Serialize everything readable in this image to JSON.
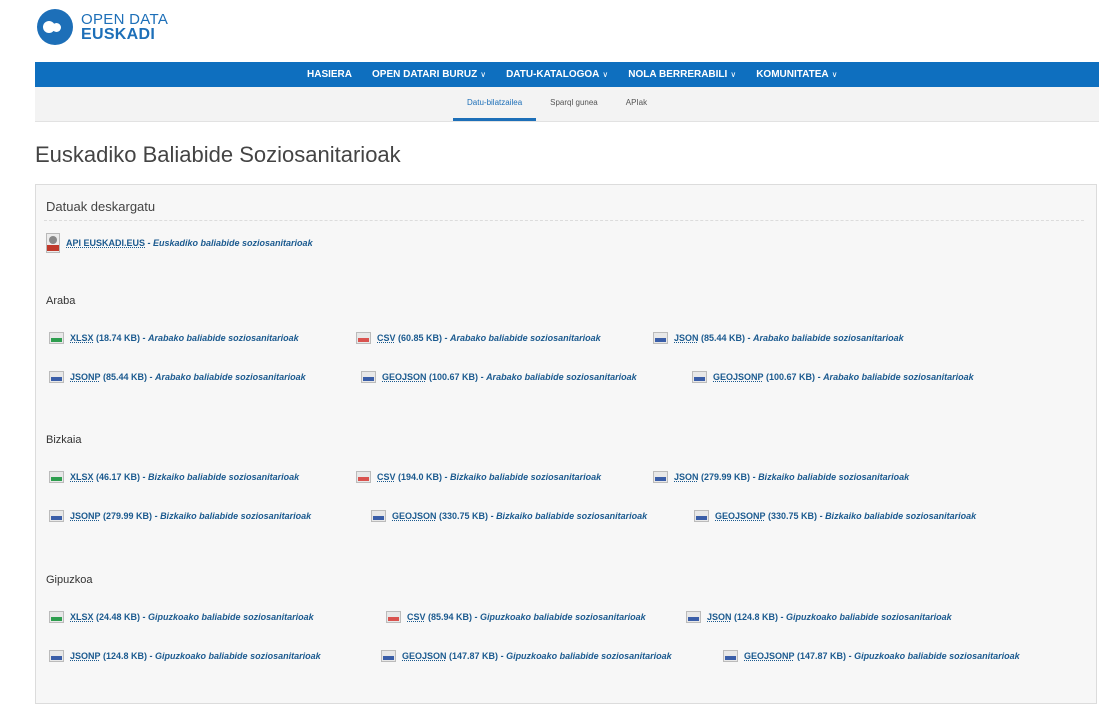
{
  "logo": {
    "line1": "OPEN DATA",
    "line2": "EUSKADI"
  },
  "mainnav": [
    {
      "label": "HASIERA",
      "dropdown": false
    },
    {
      "label": "OPEN DATARI BURUZ",
      "dropdown": true
    },
    {
      "label": "DATU-KATALOGOA",
      "dropdown": true
    },
    {
      "label": "NOLA BERRERABILI",
      "dropdown": true
    },
    {
      "label": "KOMUNITATEA",
      "dropdown": true
    }
  ],
  "subnav": [
    {
      "label": "Datu-bilatzailea",
      "active": true
    },
    {
      "label": "Sparql gunea",
      "active": false
    },
    {
      "label": "APIak",
      "active": false
    }
  ],
  "page_title": "Euskadiko Baliabide Soziosanitarioak",
  "panel": {
    "title": "Datuak deskargatu",
    "api": {
      "label": "API EUSKADI.EUS",
      "desc": "Euskadiko baliabide soziosanitarioak"
    }
  },
  "icon_colors": {
    "XLSX": "#2e9e4f",
    "CSV": "#d9534f",
    "JSON": "#3a5ea8",
    "JSONP": "#3a5ea8",
    "GEOJSON": "#3a5ea8",
    "GEOJSONP": "#3a5ea8"
  },
  "sections": [
    {
      "name": "Araba",
      "rows": [
        [
          {
            "fmt": "XLSX",
            "size": "(18.74 KB)",
            "desc": "Arabako baliabide soziosanitarioak"
          },
          {
            "fmt": "CSV",
            "size": "(60.85 KB)",
            "desc": "Arabako baliabide soziosanitarioak"
          },
          {
            "fmt": "JSON",
            "size": "(85.44 KB)",
            "desc": "Arabako baliabide soziosanitarioak"
          }
        ],
        [
          {
            "fmt": "JSONP",
            "size": "(85.44 KB)",
            "desc": "Arabako baliabide soziosanitarioak"
          },
          {
            "fmt": "GEOJSON",
            "size": "(100.67 KB)",
            "desc": "Arabako baliabide soziosanitarioak"
          },
          {
            "fmt": "GEOJSONP",
            "size": "(100.67 KB)",
            "desc": "Arabako baliabide soziosanitarioak"
          }
        ]
      ]
    },
    {
      "name": "Bizkaia",
      "rows": [
        [
          {
            "fmt": "XLSX",
            "size": "(46.17 KB)",
            "desc": "Bizkaiko baliabide soziosanitarioak"
          },
          {
            "fmt": "CSV",
            "size": "(194.0 KB)",
            "desc": "Bizkaiko baliabide soziosanitarioak"
          },
          {
            "fmt": "JSON",
            "size": "(279.99 KB)",
            "desc": "Bizkaiko baliabide soziosanitarioak"
          }
        ],
        [
          {
            "fmt": "JSONP",
            "size": "(279.99 KB)",
            "desc": "Bizkaiko baliabide soziosanitarioak"
          },
          {
            "fmt": "GEOJSON",
            "size": "(330.75 KB)",
            "desc": "Bizkaiko baliabide soziosanitarioak"
          },
          {
            "fmt": "GEOJSONP",
            "size": "(330.75 KB)",
            "desc": "Bizkaiko baliabide soziosanitarioak"
          }
        ]
      ]
    },
    {
      "name": "Gipuzkoa",
      "rows": [
        [
          {
            "fmt": "XLSX",
            "size": "(24.48 KB)",
            "desc": "Gipuzkoako baliabide soziosanitarioak"
          },
          {
            "fmt": "CSV",
            "size": "(85.94 KB)",
            "desc": "Gipuzkoako baliabide soziosanitarioak"
          },
          {
            "fmt": "JSON",
            "size": "(124.8 KB)",
            "desc": "Gipuzkoako baliabide soziosanitarioak"
          }
        ],
        [
          {
            "fmt": "JSONP",
            "size": "(124.8 KB)",
            "desc": "Gipuzkoako baliabide soziosanitarioak"
          },
          {
            "fmt": "GEOJSON",
            "size": "(147.87 KB)",
            "desc": "Gipuzkoako baliabide soziosanitarioak"
          },
          {
            "fmt": "GEOJSONP",
            "size": "(147.87 KB)",
            "desc": "Gipuzkoako baliabide soziosanitarioak"
          }
        ]
      ]
    }
  ]
}
